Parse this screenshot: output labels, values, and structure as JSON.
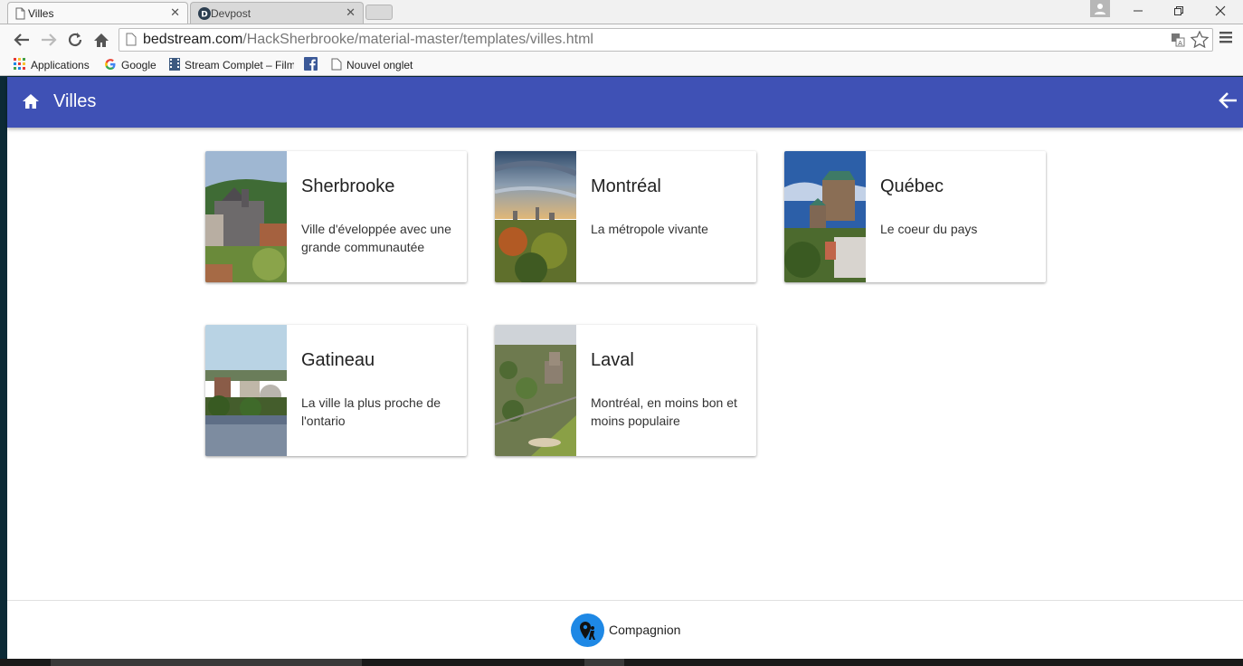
{
  "browser": {
    "tabs": [
      {
        "title": "Villes",
        "active": true
      },
      {
        "title": "Devpost",
        "active": false
      }
    ],
    "url_host": "bedstream.com",
    "url_path": "/HackSherbrooke/material-master/templates/villes.html",
    "bookmarks": [
      {
        "label": "Applications",
        "icon": "apps-grid-icon"
      },
      {
        "label": "Google",
        "icon": "google-icon"
      },
      {
        "label": "Stream Complet – Film",
        "icon": "film-icon"
      },
      {
        "label": "",
        "icon": "facebook-icon"
      },
      {
        "label": "Nouvel onglet",
        "icon": "page-icon"
      }
    ]
  },
  "appbar": {
    "title": "Villes",
    "color": "#3f51b5"
  },
  "cities": [
    {
      "name": "Sherbrooke",
      "description": "Ville d'éveloppée avec une grande communautée"
    },
    {
      "name": "Montréal",
      "description": "La métropole vivante"
    },
    {
      "name": "Québec",
      "description": "Le coeur du pays"
    },
    {
      "name": "Gatineau",
      "description": "La ville la plus proche de l'ontario"
    },
    {
      "name": "Laval",
      "description": "Montréal, en moins bon et moins populaire"
    }
  ],
  "footer": {
    "brand": "Compagnion",
    "logo_color": "#1e88e5"
  }
}
